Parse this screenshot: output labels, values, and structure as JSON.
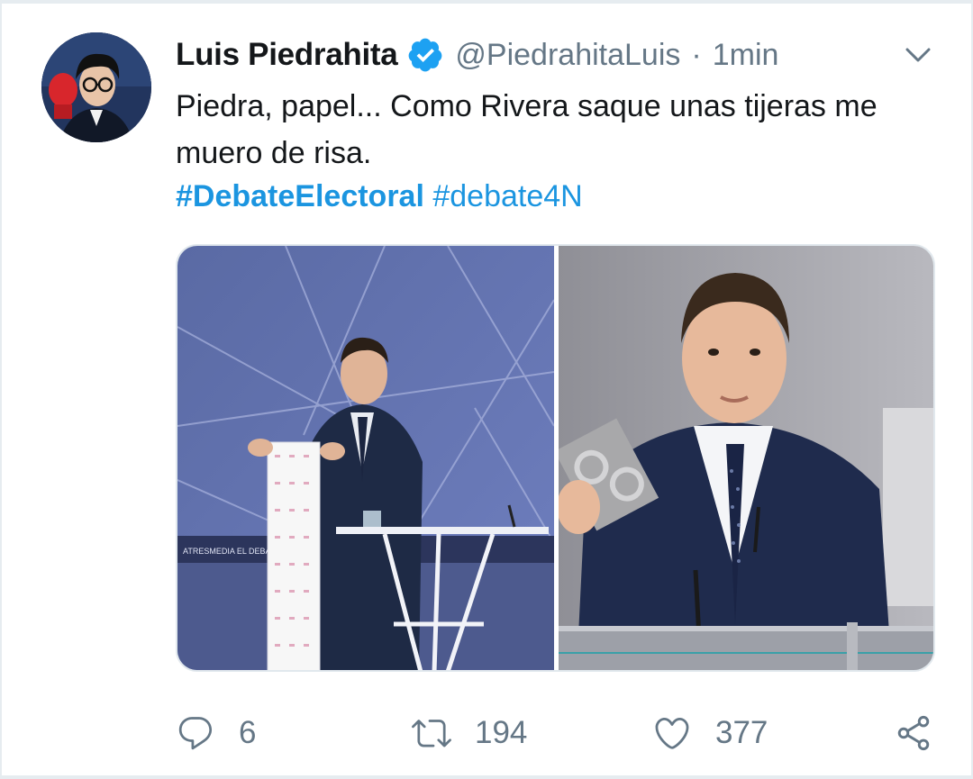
{
  "tweet": {
    "author_name": "Luis Piedrahita",
    "handle": "@PiedrahitaLuis",
    "separator": "·",
    "time": "1min",
    "text": "Piedra, papel... Como Rivera saque unas tijeras me muero de risa.",
    "hashtags": [
      "#DebateElectoral",
      "#debate4N"
    ]
  },
  "media": {
    "left_banner_text": "ATRESMEDIA EL DEBATE"
  },
  "actions": {
    "reply_count": "6",
    "retweet_count": "194",
    "like_count": "377"
  },
  "colors": {
    "link_blue": "#1b95e0",
    "secondary_text": "#657786",
    "verified_blue": "#1da1f2"
  },
  "icons": {
    "verified": "verified-badge-icon",
    "menu": "chevron-down-icon",
    "reply": "reply-icon",
    "retweet": "retweet-icon",
    "like": "heart-icon",
    "share": "share-icon"
  }
}
